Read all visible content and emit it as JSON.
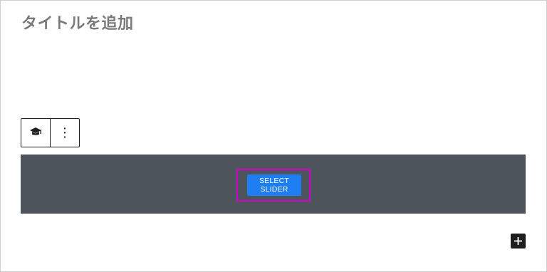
{
  "editor": {
    "title_placeholder": "タイトルを追加"
  },
  "block_toolbar": {
    "block_icon": "mortarboard-icon",
    "options_icon": "more-vertical-icon",
    "options_glyph": "⋮"
  },
  "slider_block": {
    "background_color": "#4e545b",
    "button_label": "SELECT SLIDER",
    "button_color": "#1f7ef4",
    "highlight_color": "#d100d1"
  },
  "inserter": {
    "icon": "plus-icon"
  }
}
